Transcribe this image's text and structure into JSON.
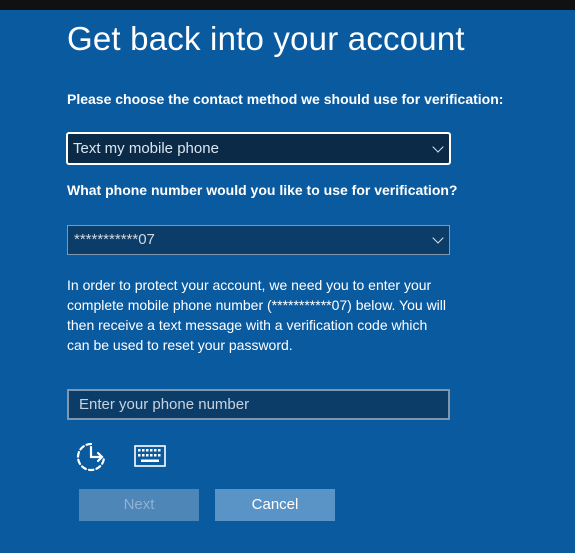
{
  "page": {
    "title": "Get back into your account"
  },
  "contact_method": {
    "label": "Please choose the contact method we should use for verification:",
    "selected": "Text my mobile phone"
  },
  "phone_choice": {
    "label": "What phone number would you like to use for verification?",
    "selected": "***********07"
  },
  "description": "In order to protect your account, we need you to enter your complete mobile phone number (***********07) below. You will then receive a text message with a verification code which can be used to reset your password.",
  "phone_input": {
    "placeholder": "Enter your phone number",
    "value": ""
  },
  "icons": {
    "ease_of_access": "ease-of-access-icon",
    "keyboard": "keyboard-icon"
  },
  "buttons": {
    "next": "Next",
    "cancel": "Cancel",
    "next_enabled": false
  },
  "colors": {
    "background": "#0a5aa0",
    "field": "#0c3d68",
    "cancel_button": "#5a93c6",
    "next_button_disabled": "#4f86b8"
  }
}
